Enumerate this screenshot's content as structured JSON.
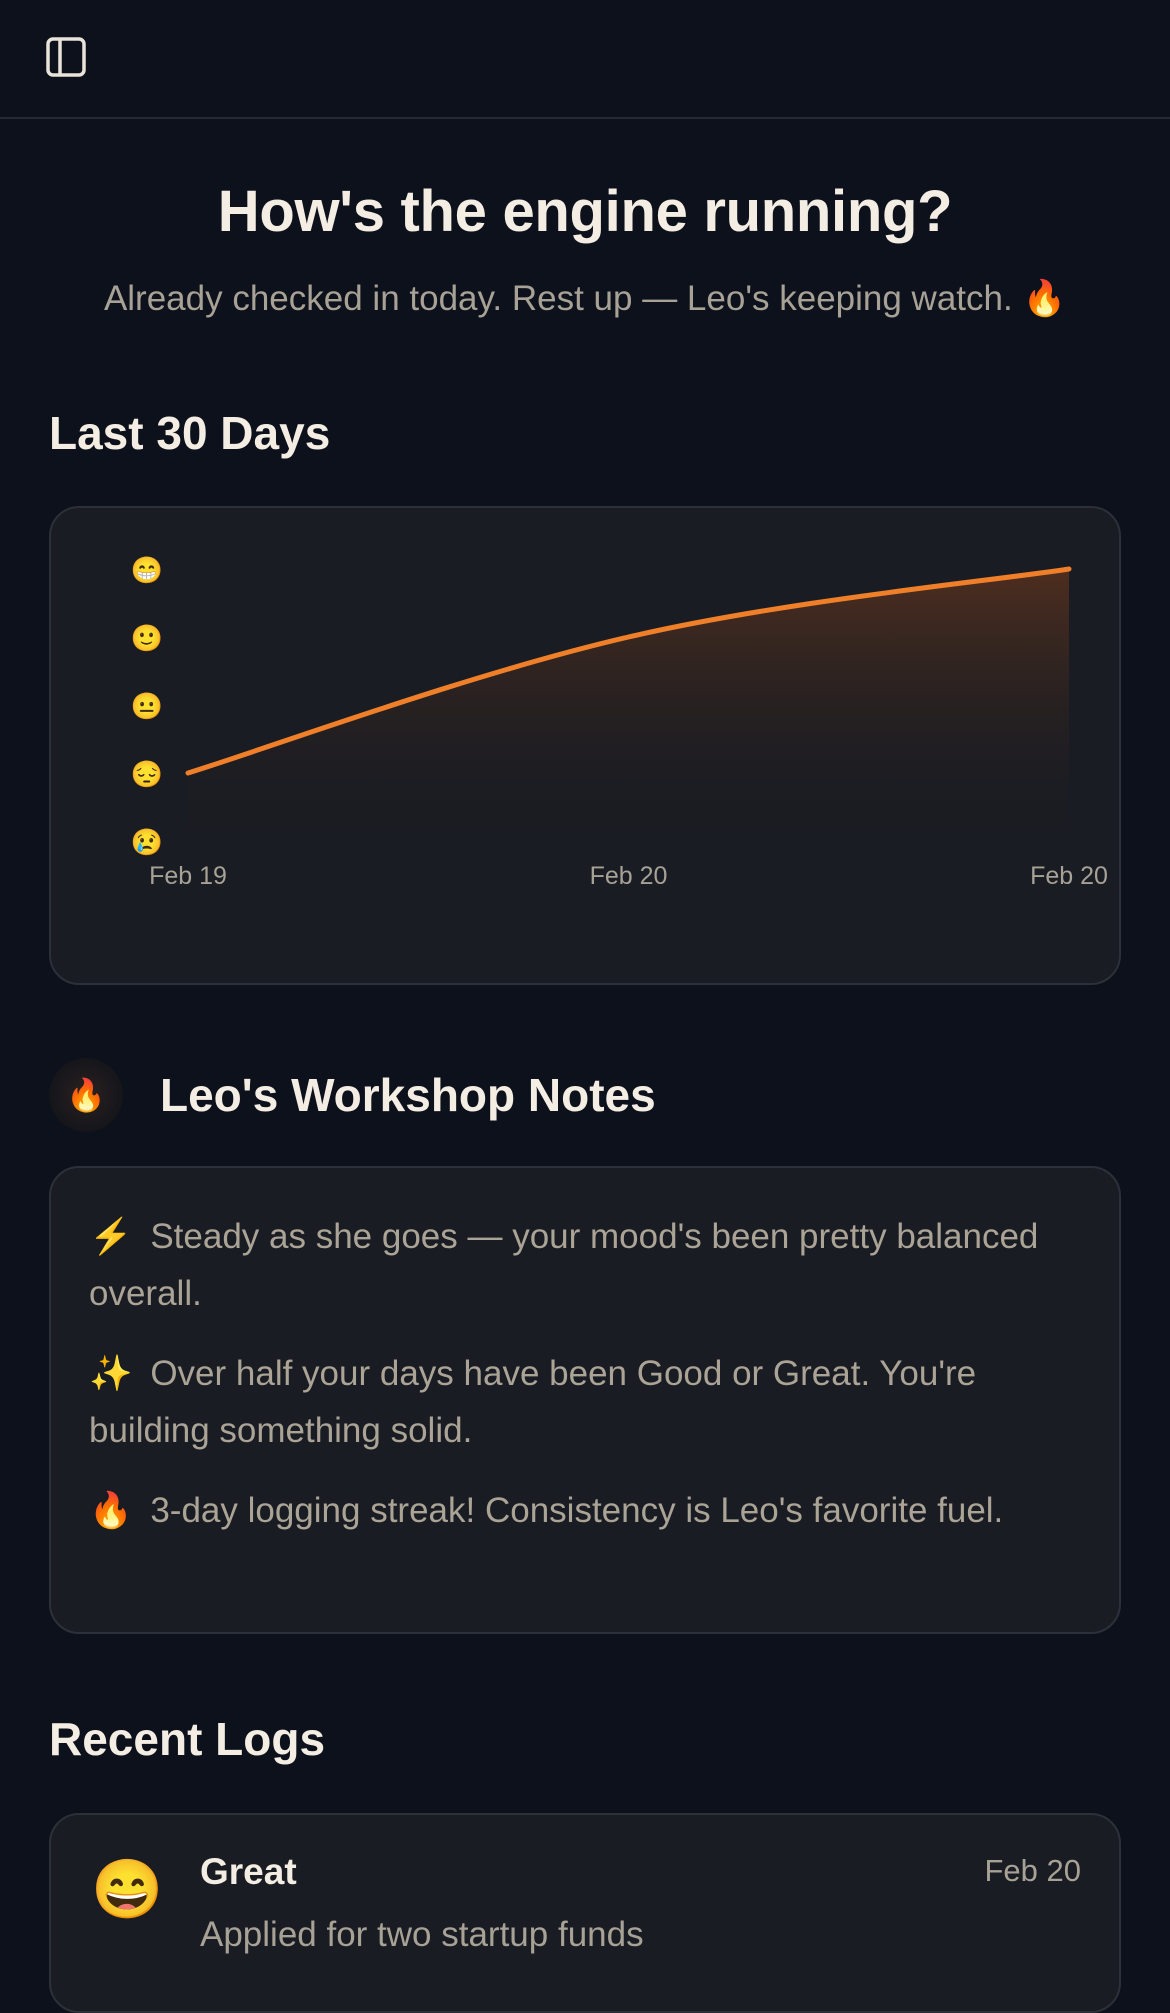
{
  "topbar": {
    "toggle_icon": "sidebar-toggle-icon"
  },
  "hero": {
    "title": "How's the engine running?",
    "subtitle": "Already checked in today. Rest up — Leo's keeping watch.",
    "subtitle_emoji": "🔥"
  },
  "chart_section": {
    "title": "Last 30 Days"
  },
  "chart_data": {
    "type": "area",
    "title": "",
    "xlabel": "",
    "ylabel": "",
    "x": [
      "Feb 19",
      "Feb 20",
      "Feb 20"
    ],
    "y_ticks": [
      "😁",
      "🙂",
      "😐",
      "😔",
      "😢"
    ],
    "y_levels": [
      5,
      4,
      3,
      2,
      1
    ],
    "ylim": [
      1,
      5
    ],
    "series": [
      {
        "values": [
          2,
          4,
          5
        ]
      }
    ],
    "line_color": "#f07f2a",
    "grid": false
  },
  "notes": {
    "icon": "🔥",
    "title": "Leo's Workshop Notes",
    "items": [
      {
        "emoji": "⚡",
        "text": "Steady as she goes — your mood's been pretty balanced overall."
      },
      {
        "emoji": "✨",
        "text": "Over half your days have been Good or Great. You're building something solid."
      },
      {
        "emoji": "🔥",
        "text": "3-day logging streak! Consistency is Leo's favorite fuel."
      }
    ]
  },
  "recent_logs": {
    "title": "Recent Logs",
    "items": [
      {
        "emoji": "😄",
        "mood": "Great",
        "date": "Feb 20",
        "text": "Applied for two startup funds"
      }
    ]
  },
  "colors": {
    "background": "#0d111b",
    "card": "#191c22",
    "accent": "#f07f2a"
  }
}
